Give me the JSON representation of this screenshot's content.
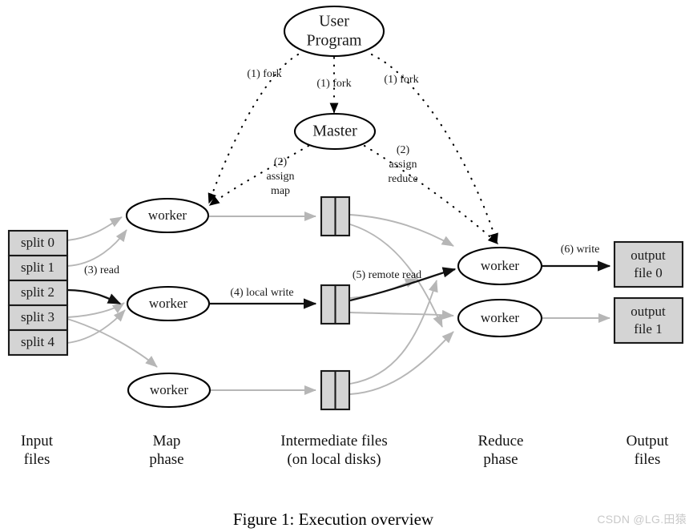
{
  "figure": {
    "caption": "Figure 1: Execution overview",
    "watermark": "CSDN @LG.田猿"
  },
  "nodes": {
    "user_program": "User\nProgram",
    "user_program_line1": "User",
    "user_program_line2": "Program",
    "master": "Master",
    "worker": "worker"
  },
  "map_workers": [
    {
      "label": "worker"
    },
    {
      "label": "worker"
    },
    {
      "label": "worker"
    }
  ],
  "reduce_workers": [
    {
      "label": "worker"
    },
    {
      "label": "worker"
    }
  ],
  "input_splits": [
    {
      "label": "split 0"
    },
    {
      "label": "split 1"
    },
    {
      "label": "split 2"
    },
    {
      "label": "split 3"
    },
    {
      "label": "split 4"
    }
  ],
  "intermediate_files": [
    {
      "label": ""
    },
    {
      "label": ""
    },
    {
      "label": ""
    }
  ],
  "output_files": [
    {
      "line1": "output",
      "line2": "file 0"
    },
    {
      "line1": "output",
      "line2": "file 1"
    }
  ],
  "edge_labels": {
    "fork_left": "(1) fork",
    "fork_center": "(1) fork",
    "fork_right": "(1) fork",
    "assign_map_l1": "(2)",
    "assign_map_l2": "assign",
    "assign_map_l3": "map",
    "assign_reduce_l1": "(2)",
    "assign_reduce_l2": "assign",
    "assign_reduce_l3": "reduce",
    "read": "(3) read",
    "local_write": "(4) local write",
    "remote_read": "(5) remote read",
    "write": "(6) write"
  },
  "column_labels": [
    {
      "line1": "Input",
      "line2": "files"
    },
    {
      "line1": "Map",
      "line2": "phase"
    },
    {
      "line1": "Intermediate files",
      "line2": "(on local disks)"
    },
    {
      "line1": "Reduce",
      "line2": "phase"
    },
    {
      "line1": "Output",
      "line2": "files"
    }
  ],
  "colors": {
    "box_fill": "#d4d4d4",
    "stroke": "#1a1a1a",
    "grey_edge": "#b6b6b6",
    "black_edge": "#111111",
    "watermark": "#c9c9c9"
  }
}
